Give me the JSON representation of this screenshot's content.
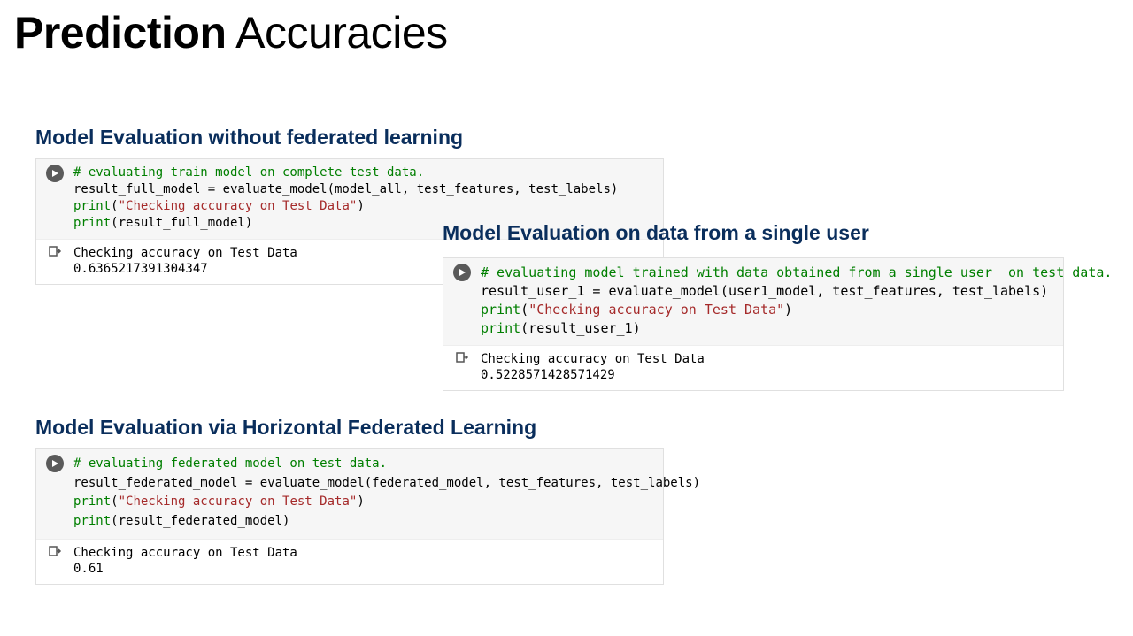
{
  "title": {
    "bold": "Prediction",
    "light": " Accuracies"
  },
  "section1": {
    "heading": "Model Evaluation without federated learning",
    "code_comment": "# evaluating train model on complete test data.",
    "code_line2": "result_full_model = evaluate_model(model_all, test_features, test_labels)",
    "code_line3a": "print",
    "code_line3b": "(",
    "code_line3_str": "\"Checking accuracy on Test Data\"",
    "code_line3c": ")",
    "code_line4a": "print",
    "code_line4b": "(result_full_model)",
    "output_line1": "Checking accuracy on Test Data",
    "output_line2": "0.6365217391304347"
  },
  "section2": {
    "heading": "Model Evaluation on data from a single user",
    "code_comment": "# evaluating model trained with data obtained from a single user  on test data.",
    "code_line2": "result_user_1 = evaluate_model(user1_model, test_features, test_labels)",
    "code_line3a": "print",
    "code_line3b": "(",
    "code_line3_str": "\"Checking accuracy on Test Data\"",
    "code_line3c": ")",
    "code_line4a": "print",
    "code_line4b": "(result_user_1)",
    "output_line1": "Checking accuracy on Test Data",
    "output_line2": "0.5228571428571429"
  },
  "section3": {
    "heading": "Model Evaluation via Horizontal Federated Learning",
    "code_comment": "# evaluating federated model on test data.",
    "code_line2": "result_federated_model = evaluate_model(federated_model, test_features, test_labels)",
    "code_line3a": "print",
    "code_line3b": "(",
    "code_line3_str": "\"Checking accuracy on Test Data\"",
    "code_line3c": ")",
    "code_line4a": "print",
    "code_line4b": "(result_federated_model)",
    "output_line1": "Checking accuracy on Test Data",
    "output_line2": "0.61"
  }
}
